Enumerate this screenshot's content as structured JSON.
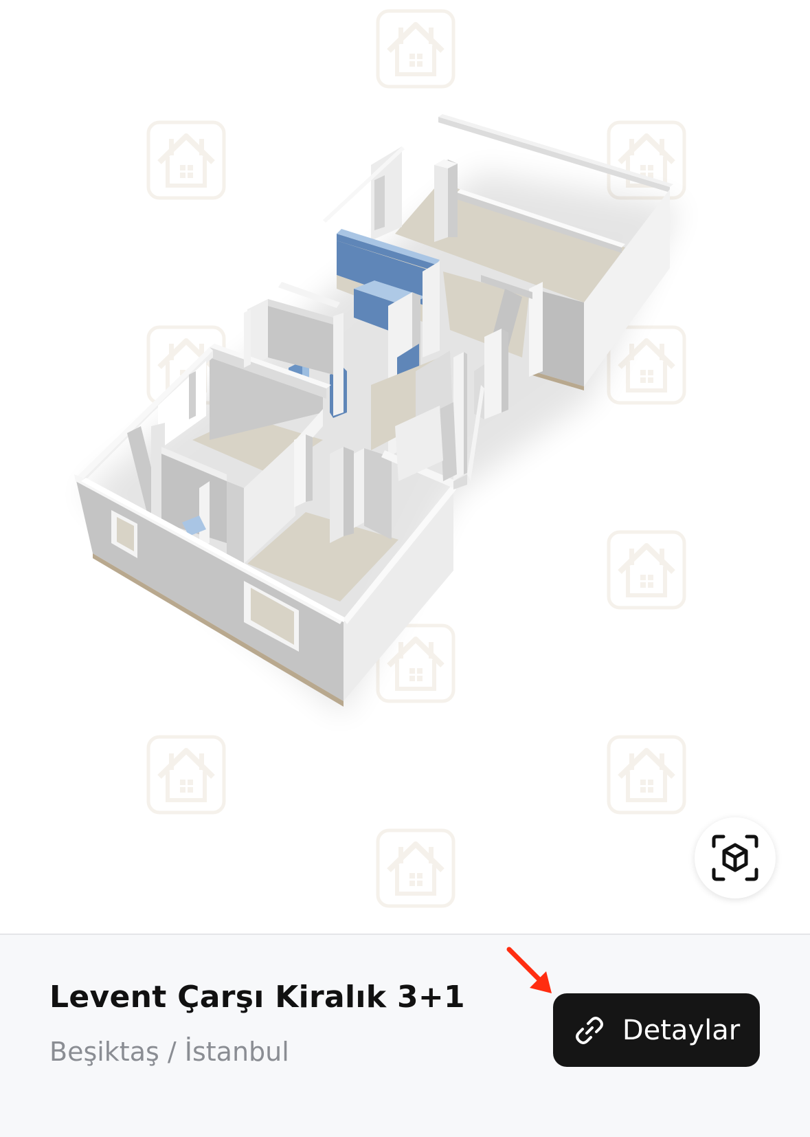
{
  "viewer": {
    "watermark_icon": "house-logo-icon",
    "ar_button_icon": "ar-cube-icon"
  },
  "listing": {
    "title": "Levent Çarşı Kiralık 3+1",
    "location": "Beşiktaş / İstanbul"
  },
  "details_button": {
    "label": "Detaylar",
    "icon": "link-icon"
  },
  "annotation": {
    "icon": "red-arrow-icon",
    "color": "#ff2d10"
  },
  "colors": {
    "button_bg": "#151515",
    "info_bar_bg": "#f7f8fa",
    "wall": "#e7e7e7",
    "floor": "#d8d3c6",
    "furniture_blue": "#5f86b8"
  }
}
